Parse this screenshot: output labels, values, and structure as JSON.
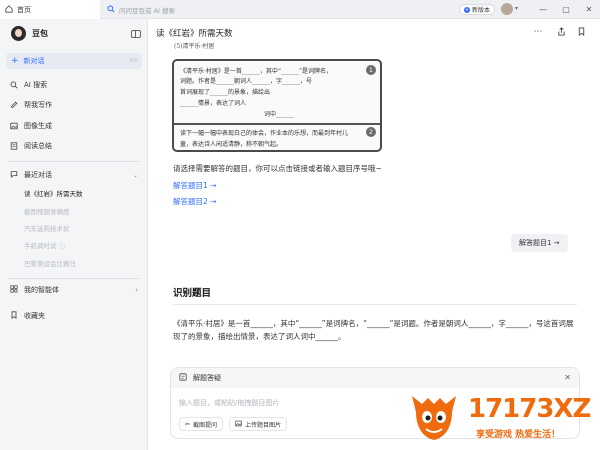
{
  "tabs": {
    "home": "首页"
  },
  "search": {
    "placeholder": "问问豆包或 AI 搜索"
  },
  "topbar": {
    "new_version": "新版本"
  },
  "sidebar": {
    "brand": "豆包",
    "new_chat": "新对话",
    "new_chat_shortcut": "⌘K",
    "nav": [
      {
        "label": "AI 搜索",
        "icon": "search-icon"
      },
      {
        "label": "帮我写作",
        "icon": "pen-icon"
      },
      {
        "label": "图像生成",
        "icon": "image-icon"
      },
      {
        "label": "阅读总结",
        "icon": "book-icon"
      }
    ],
    "recent_label": "最近对话",
    "conversations": [
      "读《红岩》所需天数",
      "截图搜题准确度",
      "汽车选购技术状",
      "手机调时试 ⓘ",
      "巴黎奥运会比赛日"
    ],
    "my_agents": "我的智能体",
    "favorites": "收藏夹"
  },
  "main": {
    "title": "读《红岩》所需天数",
    "prompt": "请选择需要解答的题目，你可以点击链接或者输入题目序号哦~",
    "links": [
      "解答题目1 →",
      "解答题目2 →"
    ],
    "answer_button": "解答题目1 →",
    "section_title": "识别题目",
    "paragraph": "《清平乐·村居》是一首______，其中“______”是词牌名，“______”是词题。作者是朝词人______，字______，号这首词展现了的景象，描绘出情景，表达了词人词中______。"
  },
  "image_text": {
    "crop_top": "(5)清平乐·村居",
    "line1": "《清平乐·村居》是一首______，其中“______”是词牌名，",
    "line2": "词题。作者是______朝词人______，字______，号",
    "line3": "首词展现了______的景象，描绘出",
    "line4": "______情景，表达了词人",
    "line5": "词中______",
    "line6": "读下一幅一幅中表现白己的体会，作业本的乐想，而最到年村儿",
    "line7": "童，表达诗人闲适清静，称不朝气起。",
    "badge1": "1",
    "badge2": "2"
  },
  "composer": {
    "title": "解题答疑",
    "placeholder": "输入题目，或粘贴/拖拽题目图片",
    "chip_screenshot": "截图提问",
    "chip_upload": "上传题目图片"
  },
  "watermark": {
    "number": "17173XZ",
    "slogan": "享受游戏 热爱生活！"
  },
  "colors": {
    "accent": "#2f6bff",
    "watermark": "#f06a0e"
  }
}
